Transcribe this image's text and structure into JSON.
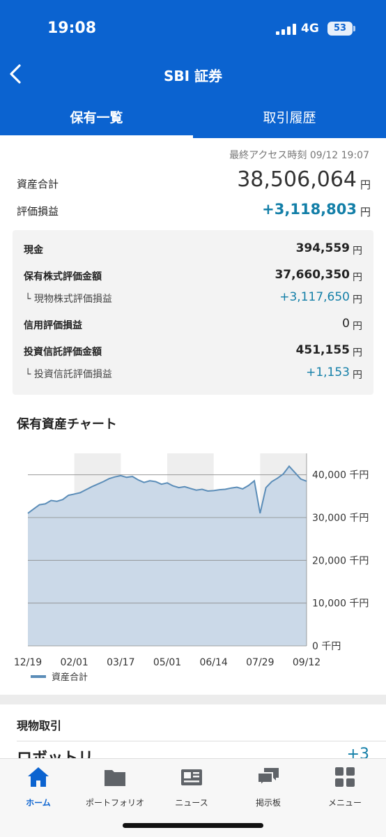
{
  "status_bar": {
    "time": "19:08",
    "network": "4G",
    "battery": "53"
  },
  "nav": {
    "title": "SBI 証券"
  },
  "tabs": [
    {
      "label": "保有一覧",
      "active": true
    },
    {
      "label": "取引履歴",
      "active": false
    }
  ],
  "summary": {
    "last_access": "最終アクセス時刻  09/12 19:07",
    "total_label": "資産合計",
    "total_value": "38,506,064",
    "pl_label": "評価損益",
    "pl_value": "+3,118,803",
    "yen": "円"
  },
  "details": [
    {
      "label": "現金",
      "value": "394,559",
      "sub": false
    },
    {
      "label": "保有株式評価金額",
      "value": "37,660,350",
      "sub": false
    },
    {
      "label": "└  現物株式評価損益",
      "value": "+3,117,650",
      "sub": true
    },
    {
      "label": "信用評価損益",
      "value": "0",
      "sub": false
    },
    {
      "label": "投資信託評価金額",
      "value": "451,155",
      "sub": false
    },
    {
      "label": "└  投資信託評価損益",
      "value": "+1,153",
      "sub": true
    }
  ],
  "chart_section_title": "保有資産チャート",
  "chart_data": {
    "type": "area",
    "x_ticks": [
      "12/19",
      "02/01",
      "03/17",
      "05/01",
      "06/14",
      "07/29",
      "09/12"
    ],
    "y_ticks": [
      "0 千円",
      "10,000 千円",
      "20,000 千円",
      "30,000 千円",
      "40,000 千円"
    ],
    "ylim": [
      0,
      45000
    ],
    "series": [
      {
        "name": "資産合計",
        "color": "#5b8db8",
        "values": [
          31000,
          32000,
          33000,
          33200,
          34000,
          33800,
          34200,
          35200,
          35500,
          35800,
          36500,
          37200,
          37800,
          38400,
          39100,
          39500,
          39800,
          39400,
          39600,
          38800,
          38200,
          38600,
          38400,
          37800,
          38100,
          37400,
          37000,
          37200,
          36800,
          36400,
          36600,
          36200,
          36300,
          36500,
          36600,
          36900,
          37100,
          36700,
          37500,
          38600,
          31000,
          37000,
          38400,
          39200,
          40200,
          42000,
          40500,
          39000,
          38500
        ]
      }
    ],
    "shaded_bands": [
      {
        "from_tick": "02/01",
        "to_tick": "03/17"
      },
      {
        "from_tick": "05/01",
        "to_tick": "06/14"
      },
      {
        "from_tick": "07/29",
        "to_tick": "09/12"
      }
    ],
    "grid": true,
    "legend": "bottom-left"
  },
  "genbutsu": {
    "title": "現物取引",
    "cut_left": "ロボットリ",
    "cut_right": "+3"
  },
  "bottom_nav": [
    {
      "label": "ホーム",
      "icon": "home-icon",
      "active": true
    },
    {
      "label": "ポートフォリオ",
      "icon": "folder-icon",
      "active": false
    },
    {
      "label": "ニュース",
      "icon": "news-icon",
      "active": false
    },
    {
      "label": "掲示板",
      "icon": "chat-icon",
      "active": false
    },
    {
      "label": "メニュー",
      "icon": "menu-grid-icon",
      "active": false
    }
  ]
}
